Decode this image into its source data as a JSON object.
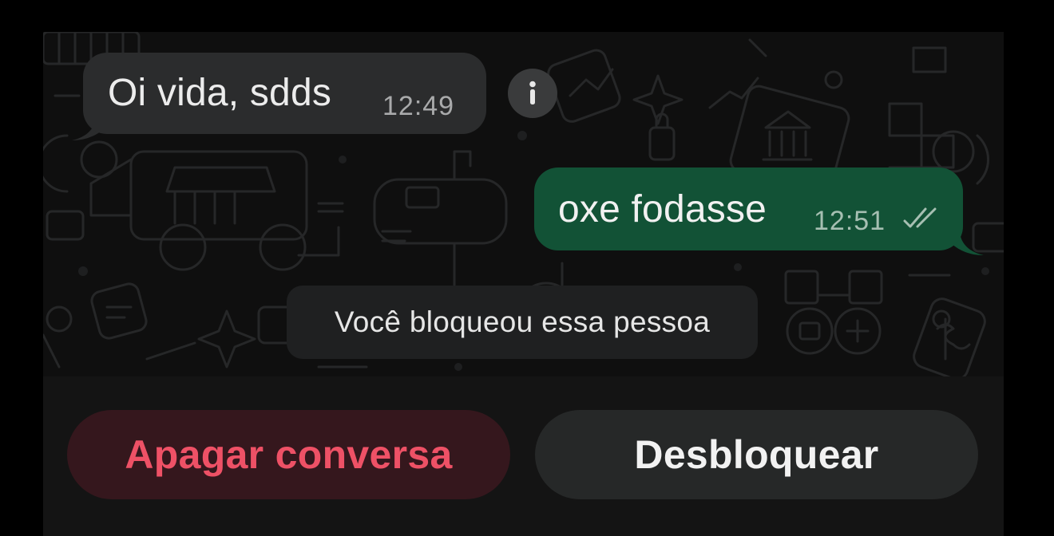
{
  "chat": {
    "messages": [
      {
        "direction": "incoming",
        "text": "Oi vida, sdds",
        "time": "12:49"
      },
      {
        "direction": "outgoing",
        "text": "oxe fodasse",
        "time": "12:51",
        "status": "double-check-icon"
      }
    ],
    "info_icon": "info-icon",
    "system_notice": "Você bloqueou essa pessoa"
  },
  "actions": {
    "delete_label": "Apagar conversa",
    "unblock_label": "Desbloquear"
  },
  "colors": {
    "incoming_bubble": "#2b2c2d",
    "outgoing_bubble": "#125236",
    "delete_text": "#ee5166",
    "delete_bg": "#35171d",
    "unblock_bg": "#262828"
  }
}
